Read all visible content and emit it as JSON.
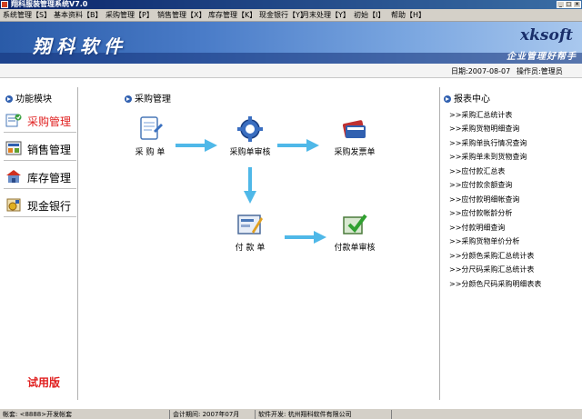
{
  "window": {
    "title": "翔科服装管理系统V7.0"
  },
  "menu": [
    {
      "label": "系统管理【S】"
    },
    {
      "label": "基本资料【B】"
    },
    {
      "label": "采购管理【P】"
    },
    {
      "label": "销售管理【X】"
    },
    {
      "label": "库存管理【K】"
    },
    {
      "label": "现金银行【Y】"
    },
    {
      "label": "月末处理【Y】"
    },
    {
      "label": "初始【I】"
    },
    {
      "label": "帮助【H】"
    }
  ],
  "banner": {
    "logo": "翔科软件",
    "brand": "xksoft",
    "slogan": "企业管理好帮手"
  },
  "info": {
    "date": "日期:2007-08-07",
    "operator": "操作员:管理员"
  },
  "left": {
    "header": "功能模块",
    "items": [
      {
        "label": "采购管理",
        "icon": "purchase-icon"
      },
      {
        "label": "销售管理",
        "icon": "sales-icon"
      },
      {
        "label": "库存管理",
        "icon": "warehouse-icon"
      },
      {
        "label": "现金银行",
        "icon": "bank-icon"
      }
    ],
    "trial": "试用版"
  },
  "center": {
    "header": "采购管理",
    "nodes": {
      "purchase_order": "采 购 单",
      "order_review": "采购单审核",
      "purchase_invoice": "采购发票单",
      "payment": "付 款 单",
      "payment_review": "付款单审核"
    }
  },
  "right": {
    "header": "报表中心",
    "reports": [
      ">>采购汇总统计表",
      ">>采购货物明细查询",
      ">>采购单执行情况查询",
      ">>采购单未到货物查询",
      ">>应付款汇总表",
      ">>应付款余额查询",
      ">>应付款明细帐查询",
      ">>应付款帐龄分析",
      ">>付款明细查询",
      ">>采购货物单价分析",
      ">>分颜色采购汇总统计表",
      ">>分尺码采购汇总统计表",
      ">>分颜色尺码采购明细表表"
    ]
  },
  "status": {
    "account": "帐套: <8888>开发帐套",
    "period": "会计期间: 2007年07月",
    "developer": "软件开发: 杭州翔科软件有限公司"
  },
  "colors": {
    "accent": "#3060b0",
    "active_text": "#e02020",
    "arrow": "#4fb8e8"
  }
}
